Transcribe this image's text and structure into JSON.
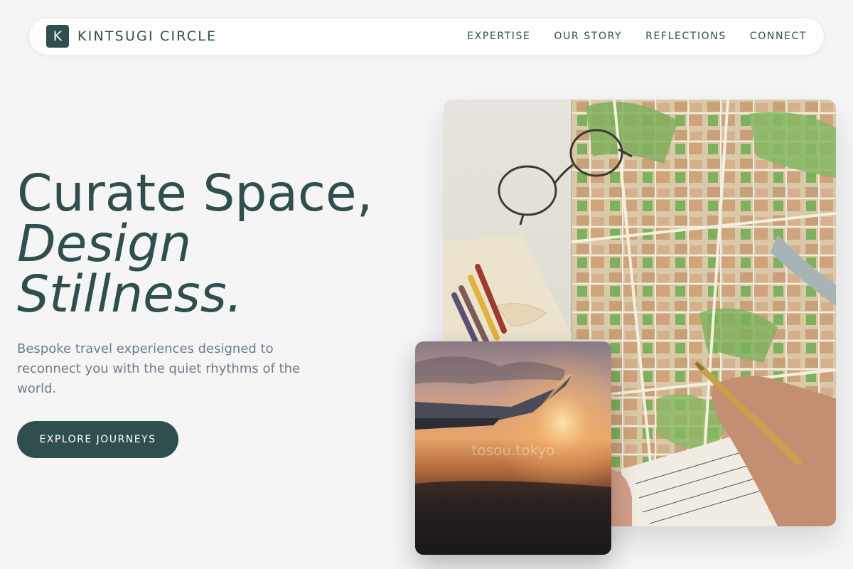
{
  "nav": {
    "logo_letter": "K",
    "brand": "KINTSUGI CIRCLE",
    "links": [
      "EXPERTISE",
      "OUR STORY",
      "REFLECTIONS",
      "CONNECT"
    ]
  },
  "hero": {
    "title_line1": "Curate Space,",
    "title_line2": "Design",
    "title_line3": "Stillness.",
    "subtitle": "Bespoke travel experiences designed to reconnect you with the quiet rhythms of the world.",
    "cta": "EXPLORE JOURNEYS"
  },
  "images": {
    "plane_watermark": "tosou.tokyo"
  },
  "colors": {
    "accent": "#2f4f4f",
    "background": "#f5f5f5",
    "subtitle_text": "#6b7c8c"
  }
}
